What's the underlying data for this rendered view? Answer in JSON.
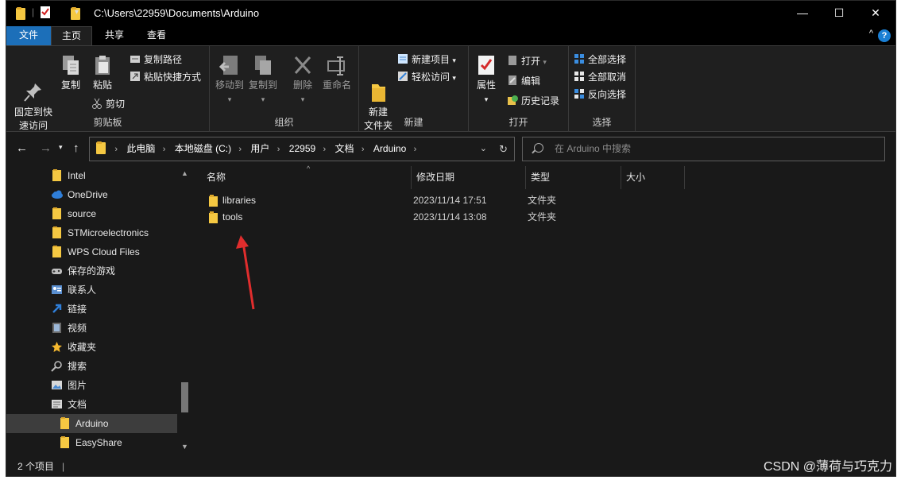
{
  "window": {
    "path_title": "C:\\Users\\22959\\Documents\\Arduino",
    "controls": {
      "minimize": "—",
      "maximize": "☐",
      "close": "✕"
    }
  },
  "tabs": [
    {
      "label": "文件"
    },
    {
      "label": "主页"
    },
    {
      "label": "共享"
    },
    {
      "label": "查看"
    }
  ],
  "help_label": "?",
  "ribbon_toggle": "^",
  "ribbon": {
    "clipboard": {
      "label": "剪贴板",
      "pin": "固定到快\n速访问",
      "copy": "复制",
      "paste": "粘贴",
      "copy_path": "复制路径",
      "paste_shortcut": "粘贴快捷方式",
      "cut": "剪切"
    },
    "organize": {
      "label": "组织",
      "move_to": "移动到",
      "copy_to": "复制到",
      "delete": "删除",
      "rename": "重命名"
    },
    "new": {
      "label": "新建",
      "new_folder": "新建\n文件夹",
      "new_item": "新建项目",
      "easy_access": "轻松访问"
    },
    "open": {
      "label": "打开",
      "properties": "属性",
      "open": "打开",
      "edit": "编辑",
      "history": "历史记录"
    },
    "select": {
      "label": "选择",
      "select_all": "全部选择",
      "select_none": "全部取消",
      "invert": "反向选择"
    }
  },
  "address": {
    "crumbs": [
      "此电脑",
      "本地磁盘 (C:)",
      "用户",
      "22959",
      "文档",
      "Arduino"
    ]
  },
  "search": {
    "placeholder": "在 Arduino 中搜索"
  },
  "sidebar": {
    "items": [
      {
        "label": "Intel",
        "icon": "folder-icon"
      },
      {
        "label": "OneDrive",
        "icon": "cloud-icon"
      },
      {
        "label": "source",
        "icon": "folder-icon"
      },
      {
        "label": "STMicroelectronics",
        "icon": "folder-icon"
      },
      {
        "label": "WPS Cloud Files",
        "icon": "folder-icon"
      },
      {
        "label": "保存的游戏",
        "icon": "gamepad-icon"
      },
      {
        "label": "联系人",
        "icon": "contacts-icon"
      },
      {
        "label": "链接",
        "icon": "link-icon"
      },
      {
        "label": "视频",
        "icon": "video-icon"
      },
      {
        "label": "收藏夹",
        "icon": "star-icon"
      },
      {
        "label": "搜索",
        "icon": "search-icon"
      },
      {
        "label": "图片",
        "icon": "picture-icon"
      },
      {
        "label": "文档",
        "icon": "document-icon"
      },
      {
        "label": "Arduino",
        "icon": "folder-icon",
        "selected": true
      },
      {
        "label": "EasyShare",
        "icon": "folder-icon"
      }
    ]
  },
  "columns": {
    "name": "名称",
    "modified": "修改日期",
    "type": "类型",
    "size": "大小"
  },
  "files": [
    {
      "name": "libraries",
      "modified": "2023/11/14 17:51",
      "type": "文件夹",
      "size": ""
    },
    {
      "name": "tools",
      "modified": "2023/11/14 13:08",
      "type": "文件夹",
      "size": ""
    }
  ],
  "status": {
    "count": "2 个项目"
  },
  "watermark": "CSDN @薄荷与巧克力",
  "colors": {
    "accent": "#1c6fb9",
    "folder": "#f5c842",
    "annotation_arrow": "#e02d2d"
  }
}
